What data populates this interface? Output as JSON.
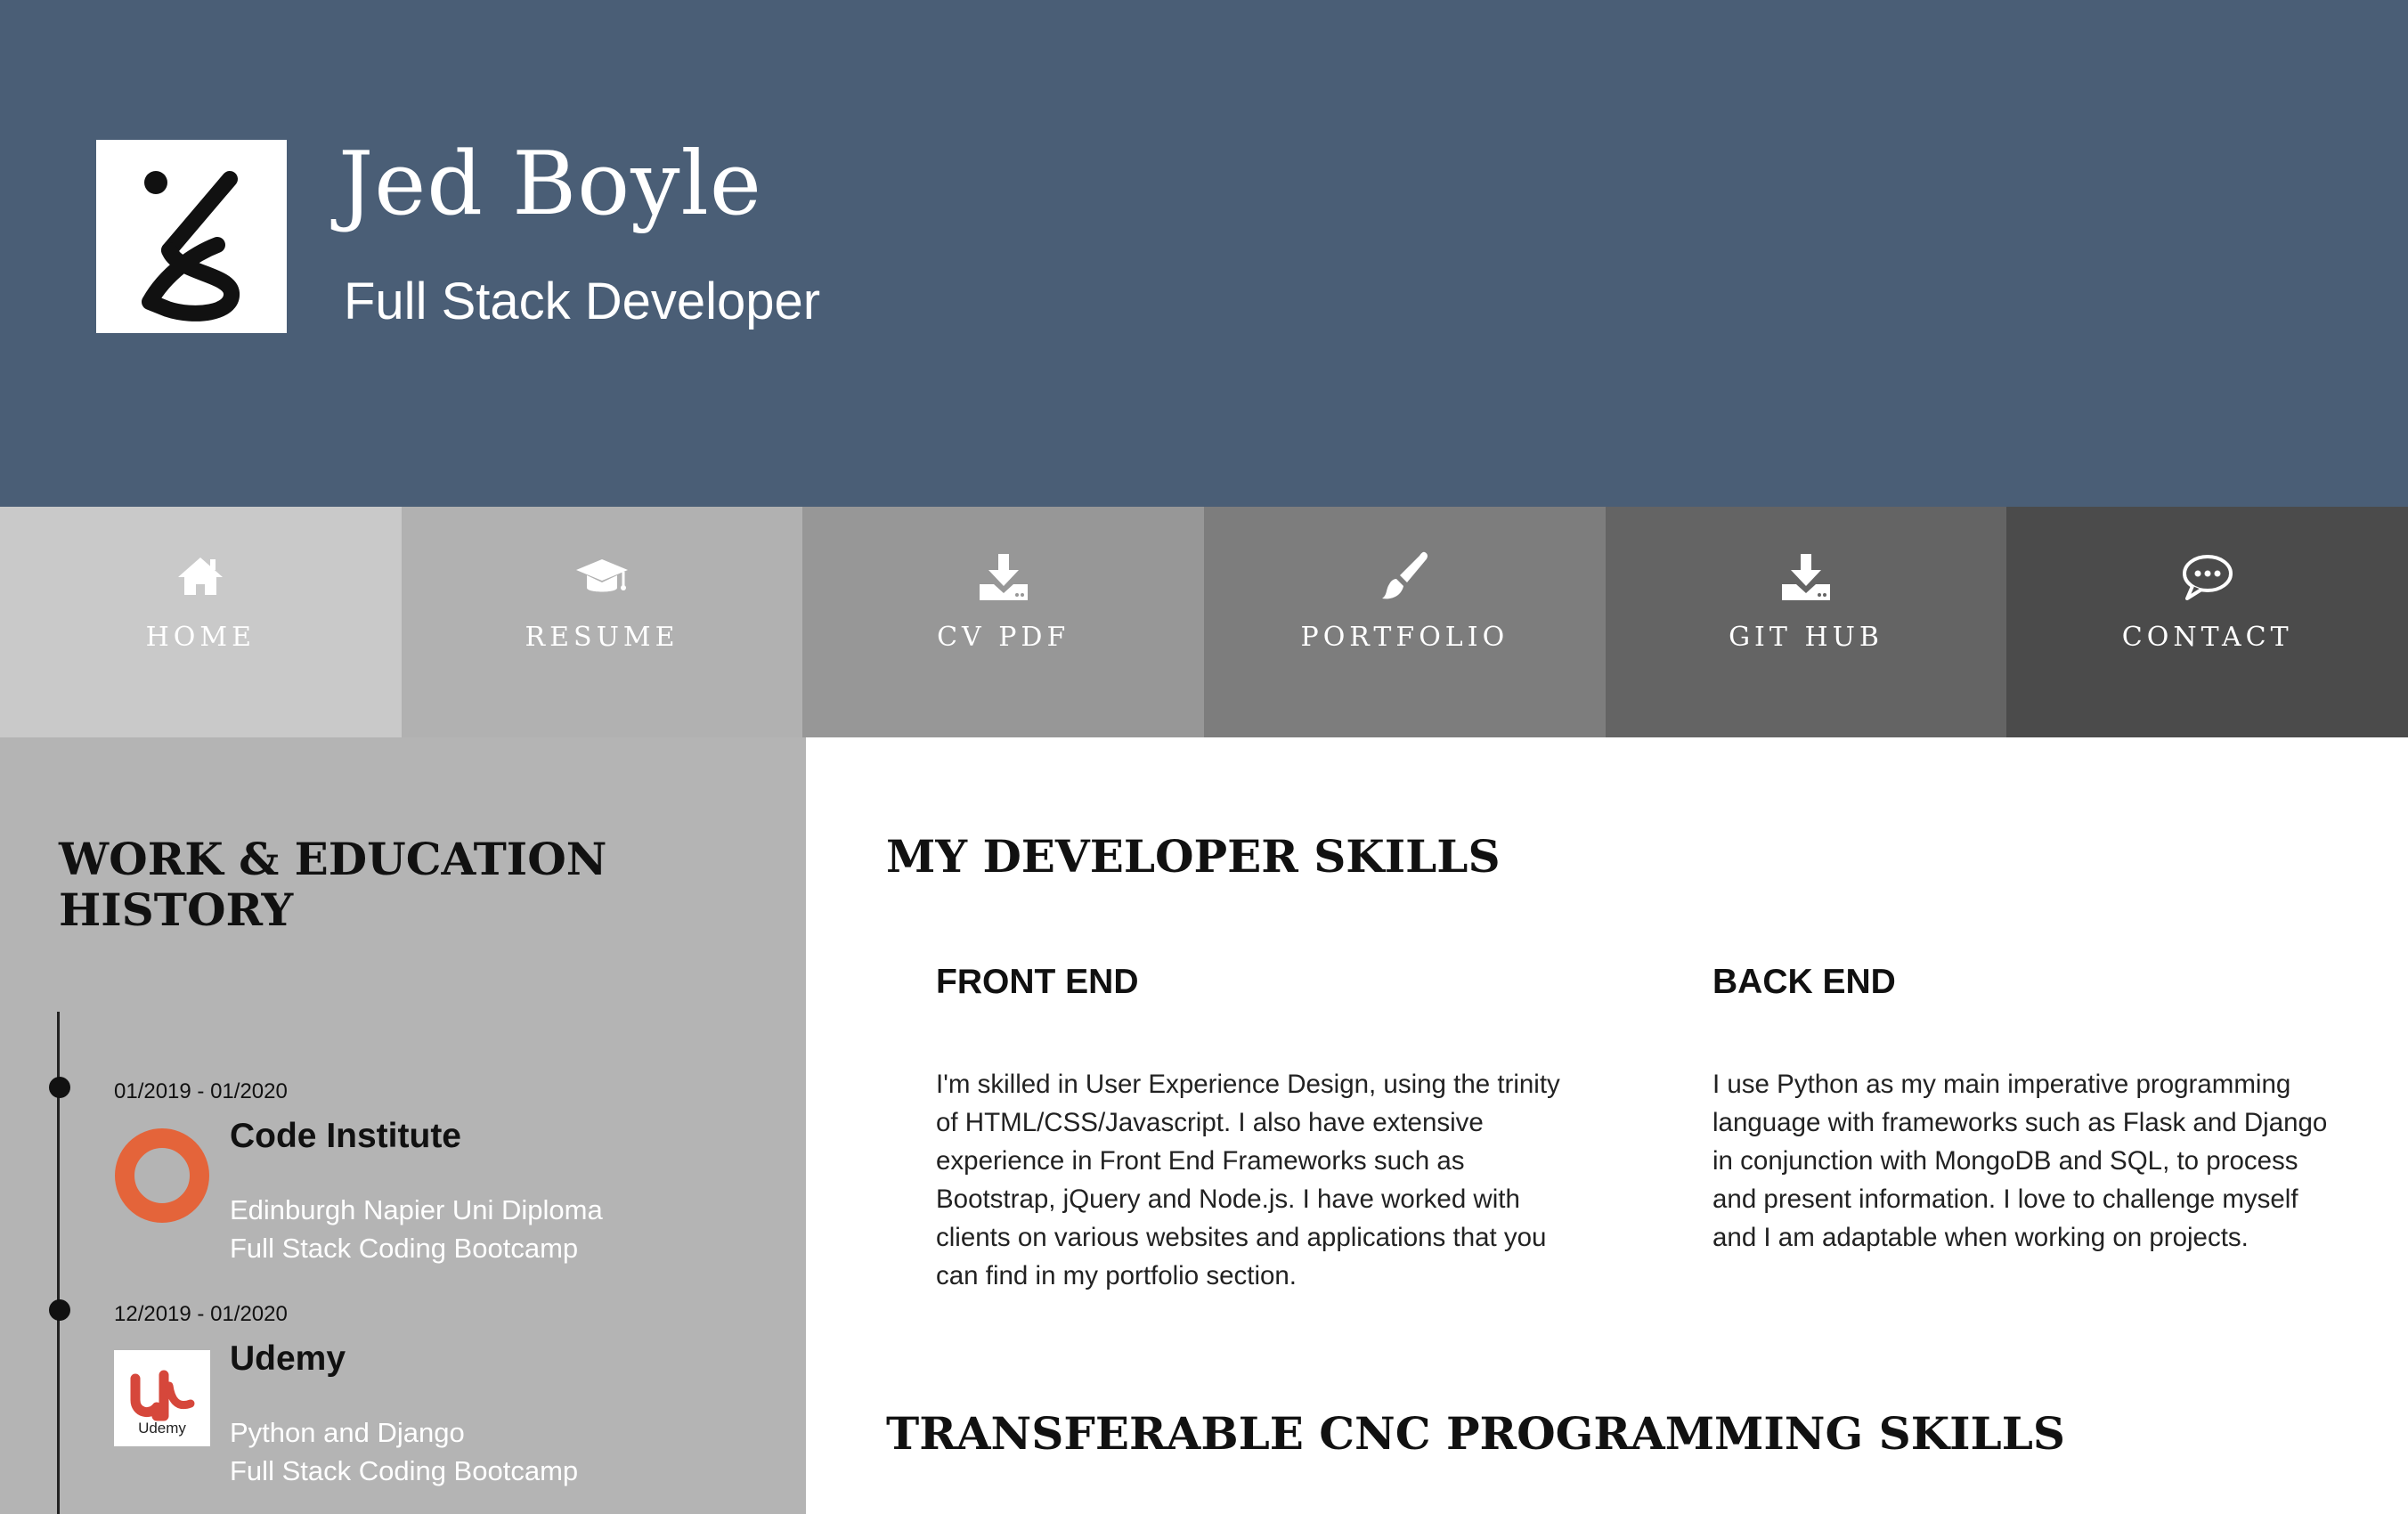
{
  "header": {
    "name": "Jed Boyle",
    "subtitle": "Full Stack Developer",
    "logo_icon": "jb-monogram-icon"
  },
  "nav": {
    "items": [
      {
        "label": "HOME",
        "icon": "home-icon",
        "bg": "#c9c9c9"
      },
      {
        "label": "RESUME",
        "icon": "graduation-cap-icon",
        "bg": "#b1b1b1"
      },
      {
        "label": "CV PDF",
        "icon": "download-icon",
        "bg": "#979797"
      },
      {
        "label": "PORTFOLIO",
        "icon": "paintbrush-icon",
        "bg": "#7d7d7d"
      },
      {
        "label": "GIT HUB",
        "icon": "download-icon",
        "bg": "#646464"
      },
      {
        "label": "CONTACT",
        "icon": "chat-bubble-icon",
        "bg": "#4b4b4b"
      }
    ]
  },
  "sidebar": {
    "title": "WORK & EDUCATION HISTORY",
    "entries": [
      {
        "date": "01/2019 - 01/2020",
        "title": "Code Institute",
        "details": [
          "Edinburgh Napier Uni Diploma",
          "Full Stack Coding Bootcamp"
        ],
        "logo_icon": "code-institute-logo-icon"
      },
      {
        "date": "12/2019 - 01/2020",
        "title": "Udemy",
        "details": [
          "Python and Django",
          "Full Stack Coding Bootcamp"
        ],
        "logo_icon": "udemy-logo-icon",
        "logo_text": "Udemy"
      }
    ]
  },
  "main": {
    "skills_heading": "MY DEVELOPER SKILLS",
    "front_end": {
      "heading": "FRONT END",
      "lines": [
        "I'm skilled in User Experience Design, using the trinity",
        "of HTML/CSS/Javascript. I also have extensive",
        "experience in Front End Frameworks such as",
        "Bootstrap, jQuery and Node.js. I have worked with",
        "clients on various websites and applications that you",
        "can find in my portfolio section."
      ]
    },
    "back_end": {
      "heading": "BACK END",
      "lines": [
        "I use Python as my main imperative programming",
        "language with frameworks such as Flask and Django",
        "in conjunction with MongoDB and SQL, to process",
        "and present information. I love to challenge myself",
        "and I am adaptable when working on projects."
      ]
    },
    "cnc_heading": "TRANSFERABLE CNC PROGRAMMING SKILLS"
  },
  "colors": {
    "header_bg": "#4a5e76",
    "sidebar_bg": "#b4b4b4",
    "code_institute_orange": "#e4643a",
    "udemy_red": "#d6473b"
  }
}
